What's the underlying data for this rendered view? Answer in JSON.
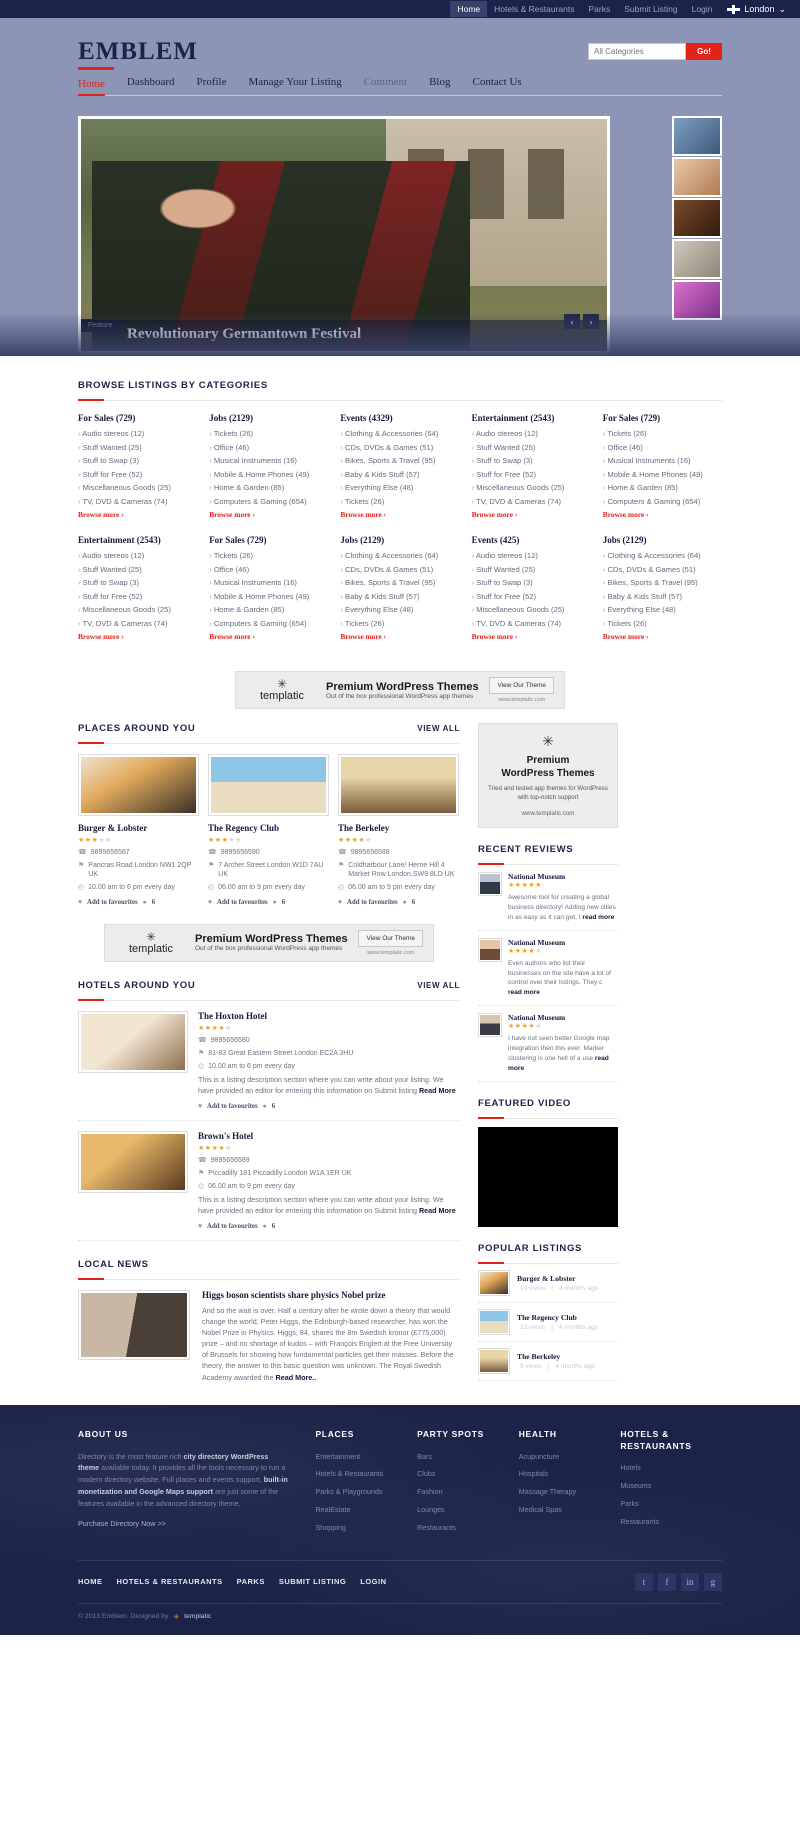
{
  "topbar": {
    "links": [
      {
        "label": "Home",
        "active": true
      },
      {
        "label": "Hotels & Restaurants",
        "active": false
      },
      {
        "label": "Parks",
        "active": false
      },
      {
        "label": "Submit Listing",
        "active": false
      },
      {
        "label": "Login",
        "active": false
      }
    ],
    "location": "London",
    "chevron": "⌄"
  },
  "header": {
    "brand": "EMBLEM",
    "search_placeholder": "All Categories",
    "search_button": "Go!",
    "nav": [
      {
        "label": "Home",
        "state": "active"
      },
      {
        "label": "Dashboard",
        "state": "normal"
      },
      {
        "label": "Profile",
        "state": "normal"
      },
      {
        "label": "Manage Your Listing",
        "state": "normal"
      },
      {
        "label": "Comment",
        "state": "muted"
      },
      {
        "label": "Blog",
        "state": "normal"
      },
      {
        "label": "Contact Us",
        "state": "normal"
      }
    ]
  },
  "slider": {
    "feature_tag": "Feature",
    "caption": "Revolutionary Germantown Festival",
    "prev": "‹",
    "next": "›"
  },
  "categories_section": {
    "title": "BROWSE LISTINGS BY CATEGORIES",
    "more_label": "Browse more ›",
    "groups": [
      {
        "title": "For Sales (729)",
        "items": [
          "Audio stereos (12)",
          "Stuff Wanted (25)",
          "Stuff to Swap (3)",
          "Stuff for Free (52)",
          "Miscellaneous Goods (25)",
          "TV, DVD & Cameras (74)"
        ]
      },
      {
        "title": "Jobs (2129)",
        "items": [
          "Tickets (26)",
          "Office (46)",
          "Musical Instruments (16)",
          "Mobile & Home Phones (49)",
          "Home & Garden (85)",
          "Computers & Gaming (654)"
        ]
      },
      {
        "title": "Events (4329)",
        "items": [
          "Clothing & Accessories (64)",
          "CDs, DVDs & Games (51)",
          "Bikes, Sports & Travel (95)",
          "Baby & Kids Stuff (57)",
          "Everything Else (48)",
          "Tickets (26)"
        ]
      },
      {
        "title": "Entertainment (2543)",
        "items": [
          "Audio stereos (12)",
          "Stuff Wanted (25)",
          "Stuff to Swap (3)",
          "Stuff for Free (52)",
          "Miscellaneous Goods (25)",
          "TV, DVD & Cameras (74)"
        ]
      },
      {
        "title": "For Sales (729)",
        "items": [
          "Tickets (26)",
          "Office (46)",
          "Musical Instruments (16)",
          "Mobile & Home Phones (49)",
          "Home & Garden (85)",
          "Computers & Gaming (654)"
        ]
      },
      {
        "title": "Entertainment (2543)",
        "items": [
          "Audio stereos (12)",
          "Stuff Wanted (25)",
          "Stuff to Swap (3)",
          "Stuff for Free (52)",
          "Miscellaneous Goods (25)",
          "TV, DVD & Cameras (74)"
        ]
      },
      {
        "title": "For Sales (729)",
        "items": [
          "Tickets (26)",
          "Office (46)",
          "Musical Instruments (16)",
          "Mobile & Home Phones (49)",
          "Home & Garden (85)",
          "Computers & Gaming (654)"
        ]
      },
      {
        "title": "Jobs (2129)",
        "items": [
          "Clothing & Accessories (64)",
          "CDs, DVDs & Games (51)",
          "Bikes, Sports & Travel (95)",
          "Baby & Kids Stuff (57)",
          "Everything Else (48)",
          "Tickets (26)"
        ]
      },
      {
        "title": "Events (425)",
        "items": [
          "Audio stereos (12)",
          "Stuff Wanted (25)",
          "Stuff to Swap (3)",
          "Stuff for Free (52)",
          "Miscellaneous Goods (25)",
          "TV, DVD & Cameras (74)"
        ]
      },
      {
        "title": "Jobs (2129)",
        "items": [
          "Clothing & Accessories (64)",
          "CDs, DVDs & Games (51)",
          "Bikes, Sports & Travel (95)",
          "Baby & Kids Stuff (57)",
          "Everything Else (48)",
          "Tickets (26)"
        ]
      }
    ]
  },
  "ad_banner": {
    "brand": "templatic",
    "star": "✳",
    "headline": "Premium WordPress Themes",
    "sub": "Out of the box professional WordPress app themes",
    "button": "View Our Theme",
    "url": "www.templatic.com"
  },
  "places_section": {
    "title": "PLACES AROUND YOU",
    "view_all": "VIEW ALL",
    "fav_label": "Add to favourites",
    "items": [
      {
        "name": "Burger & Lobster",
        "rating": 3,
        "phone": "9895656567",
        "address": "Pancras Road London NW1 2QP UK",
        "hours": "10.00 am to 6 pm every day",
        "comments": "6",
        "thumb": "ph-food"
      },
      {
        "name": "The Regency Club",
        "rating": 3,
        "phone": "9895656590",
        "address": "7 Archer Street London W1D 7AU UK",
        "hours": "06.00 am to 9 pm every day",
        "comments": "6",
        "thumb": "ph-beach"
      },
      {
        "name": "The Berkeley",
        "rating": 4,
        "phone": "9895656588",
        "address": "Coldharbour Lane/ Herne Hill 4 Market Row London,SW9 8LD UK",
        "hours": "06.00 am to 9 pm every day",
        "comments": "6",
        "thumb": "ph-hotel"
      }
    ]
  },
  "hotels_section": {
    "title": "HOTELS AROUND YOU",
    "view_all": "VIEW ALL",
    "fav_label": "Add to favourites",
    "read_more": "Read More",
    "items": [
      {
        "name": "The Hoxton Hotel",
        "rating": 4,
        "phone": "9895656580",
        "address": "81-83 Great Eastern Street London EC2A 3HU",
        "hours": "10.00 am to 6 pm every day",
        "description": "This is a listing description section where you can write about your listing. We have provided an editor for entering this information on Submit listing ",
        "comments": "6",
        "thumb": "ph-hoxton"
      },
      {
        "name": "Brown's Hotel",
        "rating": 4,
        "phone": "9895656589",
        "address": "Piccadilly 181 Piccadilly London W1A 1ER UK",
        "hours": "06.00 am to 9 pm every day",
        "description": "This is a listing description section where you can write about your listing. We have provided an editor for entering this information on Submit listing ",
        "comments": "6",
        "thumb": "ph-browns"
      }
    ]
  },
  "news_section": {
    "title": "LOCAL NEWS",
    "headline": "Higgs boson scientists share physics Nobel prize",
    "body": "And so the wait is over. Half a century after he wrote down a theory that would change the world, Peter Higgs, the Edinburgh-based researcher, has won the Nobel Prize in Physics. Higgs, 84, shares the 8m Swedish kronor (£775,000) prize – and no shortage of kudos – with François Englert at the Free University of Brussels for showing how fundamental particles get their masses. Before the theory, the answer to this basic question was unknown. The Royal Swedish Academy awarded the ",
    "read_more": "Read More.."
  },
  "sidebar": {
    "ad": {
      "star": "✳",
      "line1": "Premium",
      "line2": "WordPress Themes",
      "sub": "Tried and tested app themes for WordPress with top-notch support",
      "url": "www.templatic.com"
    },
    "reviews": {
      "title": "RECENT REVIEWS",
      "read_more": "read more",
      "items": [
        {
          "name": "National Museum",
          "rating": 5,
          "text": "Awesome tool for creating a global business directory! Adding new cities in as easy as it can get, t",
          "avatar": "av1"
        },
        {
          "name": "National Museum",
          "rating": 4,
          "text": "Even authors who list their businesses on the site have a lot of control over their listings. They c",
          "avatar": "av2"
        },
        {
          "name": "National Museum",
          "rating": 4,
          "text": "I have not seen better Google map integration then this ever. Marker clustering is one hell of a use",
          "avatar": "av3"
        }
      ]
    },
    "video": {
      "title": "FEATURED VIDEO"
    },
    "popular": {
      "title": "POPULAR LISTINGS",
      "items": [
        {
          "name": "Burger & Lobster",
          "views": "14 views",
          "time": "4 months ago",
          "thumb": "ph-food"
        },
        {
          "name": "The Regency Club",
          "views": "13 views",
          "time": "4 months ago",
          "thumb": "ph-beach"
        },
        {
          "name": "The Berkeley",
          "views": "9 views",
          "time": "4 months ago",
          "thumb": "ph-hotel"
        }
      ]
    }
  },
  "footer": {
    "about": {
      "title": "ABOUT US",
      "p1": "Directory is the most feature rich ",
      "b1": "city directory WordPress theme",
      "p2": " available today. It provides all the tools necessary to run a modern directory website. Full places and events support, ",
      "b2": "built-in monetization and Google Maps support",
      "p3": " are just some of the features available in the advanced directory theme.",
      "buy": "Purchase Directory Now >>"
    },
    "columns": [
      {
        "title": "PLACES",
        "links": [
          "Entertainment",
          "Hotels & Restaurants",
          "Parks & Playgrounds",
          "RealEstate",
          "Shopping"
        ]
      },
      {
        "title": "PARTY SPOTS",
        "links": [
          "Bars",
          "Clubs",
          "Fashion",
          "Lounges",
          "Restaurants"
        ]
      },
      {
        "title": "HEALTH",
        "links": [
          "Acupuncture",
          "Hospitals",
          "Massage Therapy",
          "Medical Spas"
        ]
      },
      {
        "title": "HOTELS & RESTAURANTS",
        "links": [
          "Hotels",
          "Museums",
          "Parks",
          "Restaurants"
        ]
      }
    ],
    "bottom_links": [
      "HOME",
      "HOTELS & RESTAURANTS",
      "PARKS",
      "SUBMIT LISTING",
      "LOGIN"
    ],
    "social": [
      "t",
      "f",
      "in",
      "g"
    ],
    "copyright": "© 2013 Emblem. Designed by ",
    "copyright_brand": "templatic",
    "copyright_star": "✳"
  }
}
